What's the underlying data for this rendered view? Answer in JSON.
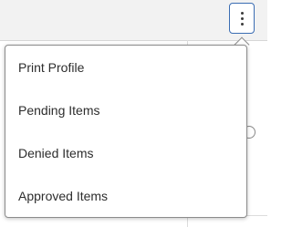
{
  "header": {
    "more_button_icon": "more-vertical-icon"
  },
  "menu": {
    "items": [
      {
        "label": "Print Profile"
      },
      {
        "label": "Pending Items"
      },
      {
        "label": "Denied Items"
      },
      {
        "label": "Approved Items"
      }
    ]
  },
  "colors": {
    "button_border": "#3b6db3",
    "menu_border": "#8c8c8c",
    "text": "#2d2d2d",
    "header_background": "#f2f2f2"
  }
}
